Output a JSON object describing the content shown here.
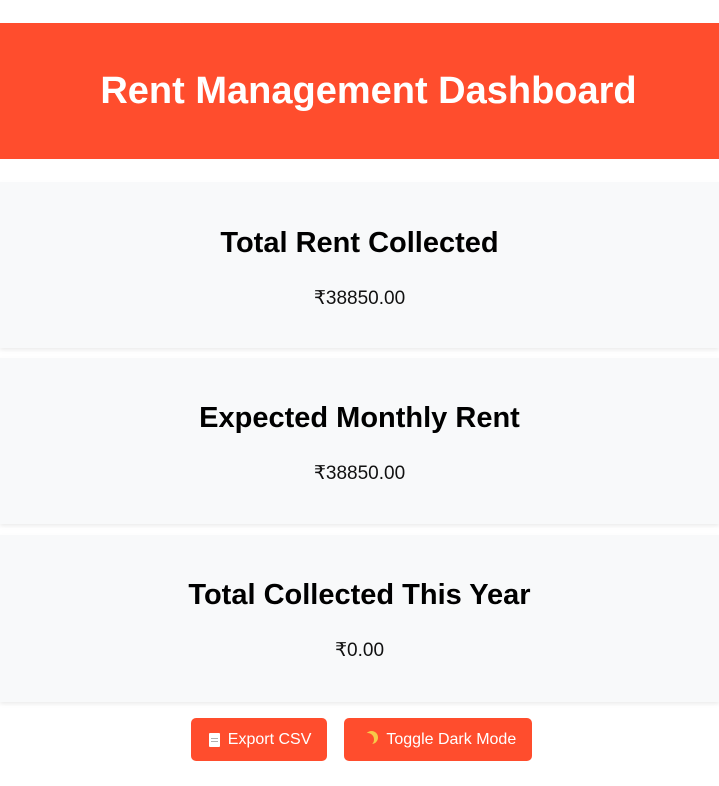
{
  "header": {
    "title": "Rent Management Dashboard"
  },
  "cards": [
    {
      "title": "Total Rent Collected",
      "amount": "₹38850.00"
    },
    {
      "title": "Expected Monthly Rent",
      "amount": "₹38850.00"
    },
    {
      "title": "Total Collected This Year",
      "amount": "₹0.00"
    }
  ],
  "actions": {
    "export": {
      "icon": "document-icon",
      "label": "Export CSV"
    },
    "dark_mode": {
      "icon": "moon-icon",
      "label": "Toggle Dark Mode"
    }
  },
  "colors": {
    "accent": "#ff4d2d",
    "card_background": "#f8f9fa"
  }
}
